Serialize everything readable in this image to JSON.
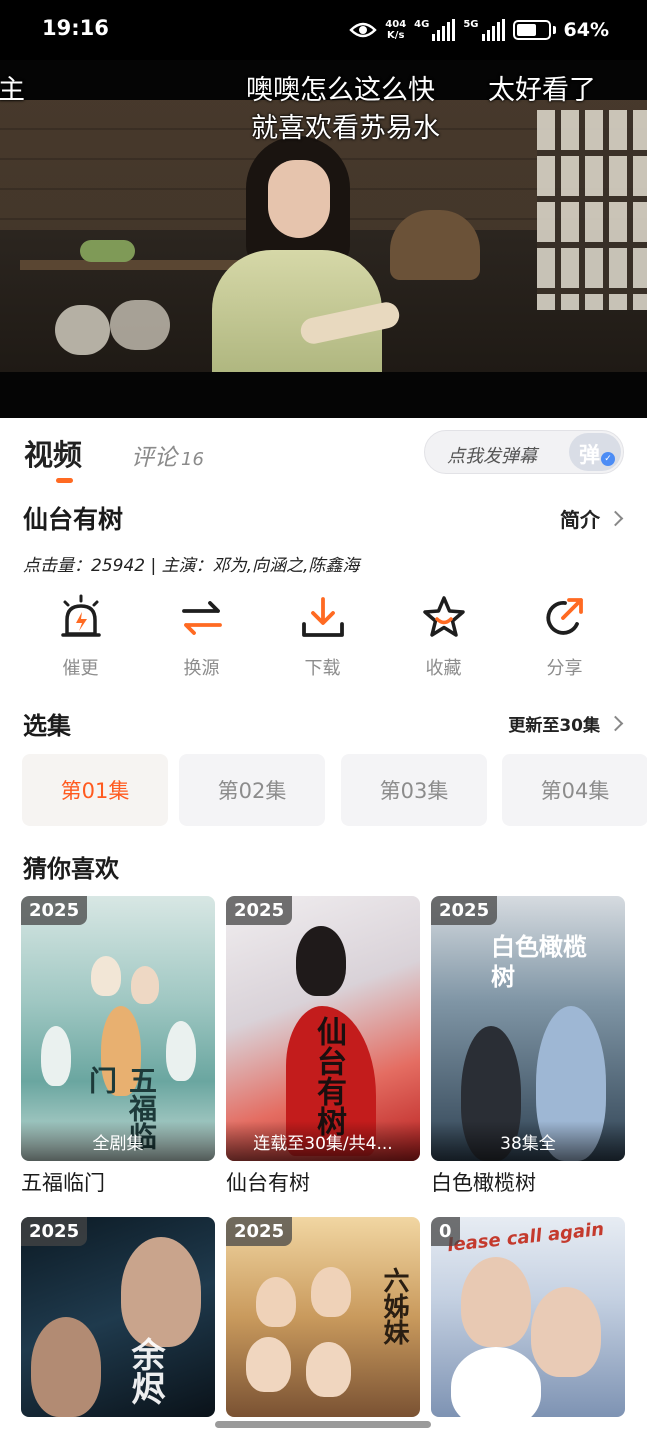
{
  "status_bar": {
    "time": "19:16",
    "net_speed_value": "404",
    "net_speed_unit": "K/s",
    "signal1_label": "4G",
    "signal2_label": "5G",
    "battery_percent": "64%",
    "battery_level": 0.64
  },
  "video": {
    "danmaku": [
      "主",
      "噢噢怎么这么快",
      "太好看了",
      "就喜欢看苏易水"
    ]
  },
  "tabs": {
    "video_label": "视频",
    "comment_label": "评论",
    "comment_count": "16",
    "danmaku_prompt": "点我发弹幕",
    "danmaku_toggle_char": "弹"
  },
  "show": {
    "title": "仙台有树",
    "intro_label": "简介",
    "meta": "点击量：25942 | 主演：邓为,向涵之,陈鑫海"
  },
  "actions": [
    {
      "label": "催更",
      "icon": "alarm-icon"
    },
    {
      "label": "换源",
      "icon": "switch-source-icon"
    },
    {
      "label": "下载",
      "icon": "download-icon"
    },
    {
      "label": "收藏",
      "icon": "star-icon"
    },
    {
      "label": "分享",
      "icon": "share-icon"
    }
  ],
  "episodes": {
    "heading": "选集",
    "update_label": "更新至30集",
    "items": [
      "第01集",
      "第02集",
      "第03集",
      "第04集"
    ],
    "active_index": 0
  },
  "recommend": {
    "heading": "猜你喜欢",
    "items": [
      {
        "year": "2025",
        "status": "全剧集",
        "title": "五福临门",
        "poster_text": "五福临门"
      },
      {
        "year": "2025",
        "status": "连载至30集/共4...",
        "title": "仙台有树",
        "poster_text": "仙台有树"
      },
      {
        "year": "2025",
        "status": "38集全",
        "title": "白色橄榄树",
        "poster_text": "白色橄榄树"
      },
      {
        "year": "2025",
        "status": "",
        "title": "",
        "poster_text": "余烬"
      },
      {
        "year": "2025",
        "status": "",
        "title": "",
        "poster_text": "六姊妹"
      },
      {
        "year": "0",
        "status": "",
        "title": "",
        "poster_text": "lease call again"
      }
    ]
  },
  "colors": {
    "accent": "#ff6a22",
    "icon_dark": "#1e1e1e"
  }
}
